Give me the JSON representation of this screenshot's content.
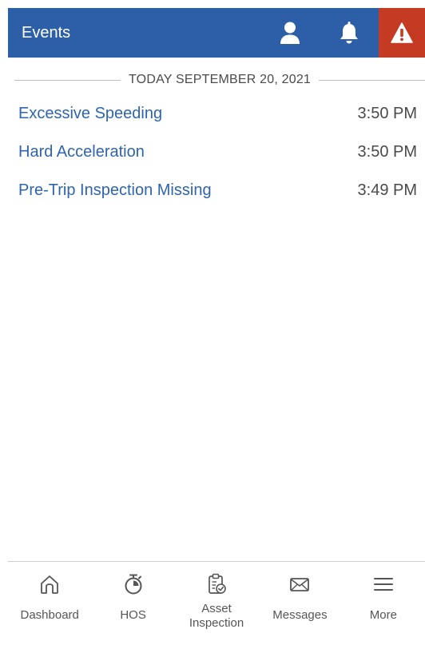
{
  "header": {
    "title": "Events",
    "accent_color": "#2d5ea8",
    "alert_color": "#c43a22",
    "icons": [
      "user-icon",
      "bell-icon",
      "alert-triangle-icon"
    ]
  },
  "date_divider": "TODAY SEPTEMBER 20, 2021",
  "events": [
    {
      "title": "Excessive Speeding",
      "time": "3:50 PM"
    },
    {
      "title": "Hard Acceleration",
      "time": "3:50 PM"
    },
    {
      "title": "Pre-Trip Inspection Missing",
      "time": "3:49 PM"
    }
  ],
  "bottom_nav": [
    {
      "label": "Dashboard",
      "icon": "home-icon"
    },
    {
      "label": "HOS",
      "icon": "stopwatch-icon"
    },
    {
      "label": "Asset Inspection",
      "icon": "clipboard-check-icon"
    },
    {
      "label": "Messages",
      "icon": "envelope-icon"
    },
    {
      "label": "More",
      "icon": "menu-icon"
    }
  ]
}
